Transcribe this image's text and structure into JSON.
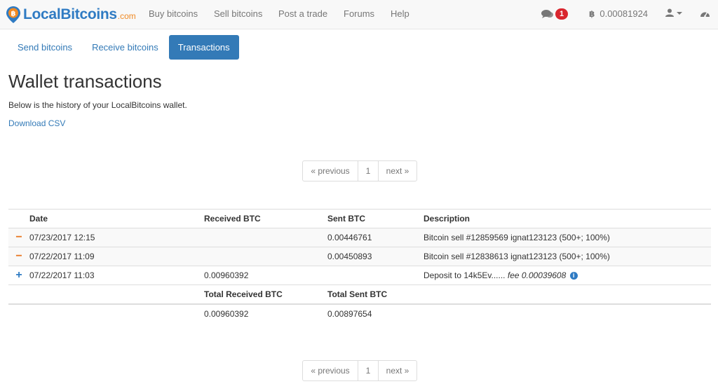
{
  "brand": {
    "name": "LocalBitcoins",
    "suffix": ".com"
  },
  "nav": {
    "buy": "Buy bitcoins",
    "sell": "Sell bitcoins",
    "post": "Post a trade",
    "forums": "Forums",
    "help": "Help"
  },
  "nav_right": {
    "messages_count": "1",
    "balance": "0.00081924",
    "chat_icon": "chat-bubbles-icon",
    "bitcoin_icon": "bitcoin-icon",
    "user_icon": "user-icon",
    "dashboard_icon": "dashboard-gauge-icon"
  },
  "tabs": [
    {
      "label": "Send bitcoins",
      "active": false
    },
    {
      "label": "Receive bitcoins",
      "active": false
    },
    {
      "label": "Transactions",
      "active": true
    }
  ],
  "page": {
    "title": "Wallet transactions",
    "intro": "Below is the history of your LocalBitcoins wallet.",
    "download_csv": "Download CSV"
  },
  "pagination": {
    "previous": "« previous",
    "current": "1",
    "next": "next »"
  },
  "table": {
    "headers": {
      "date": "Date",
      "received": "Received BTC",
      "sent": "Sent BTC",
      "description": "Description"
    },
    "rows": [
      {
        "type": "sent",
        "date": "07/23/2017 12:15",
        "received": "",
        "sent": "0.00446761",
        "description": "Bitcoin sell #12859569 ignat123123 (500+; 100%)"
      },
      {
        "type": "sent",
        "date": "07/22/2017 11:09",
        "received": "",
        "sent": "0.00450893",
        "description": "Bitcoin sell #12838613 ignat123123 (500+; 100%)"
      },
      {
        "type": "received",
        "date": "07/22/2017 11:03",
        "received": "0.00960392",
        "sent": "",
        "description": "Deposit to 14k5Ev......",
        "fee": "fee 0.00039608"
      }
    ],
    "totals": {
      "received_label": "Total Received BTC",
      "sent_label": "Total Sent BTC",
      "received": "0.00960392",
      "sent": "0.00897654"
    }
  },
  "colors": {
    "accent": "#337ab7",
    "brand_orange": "#f08a24",
    "minus": "#e8731b",
    "badge": "#d9262e"
  }
}
